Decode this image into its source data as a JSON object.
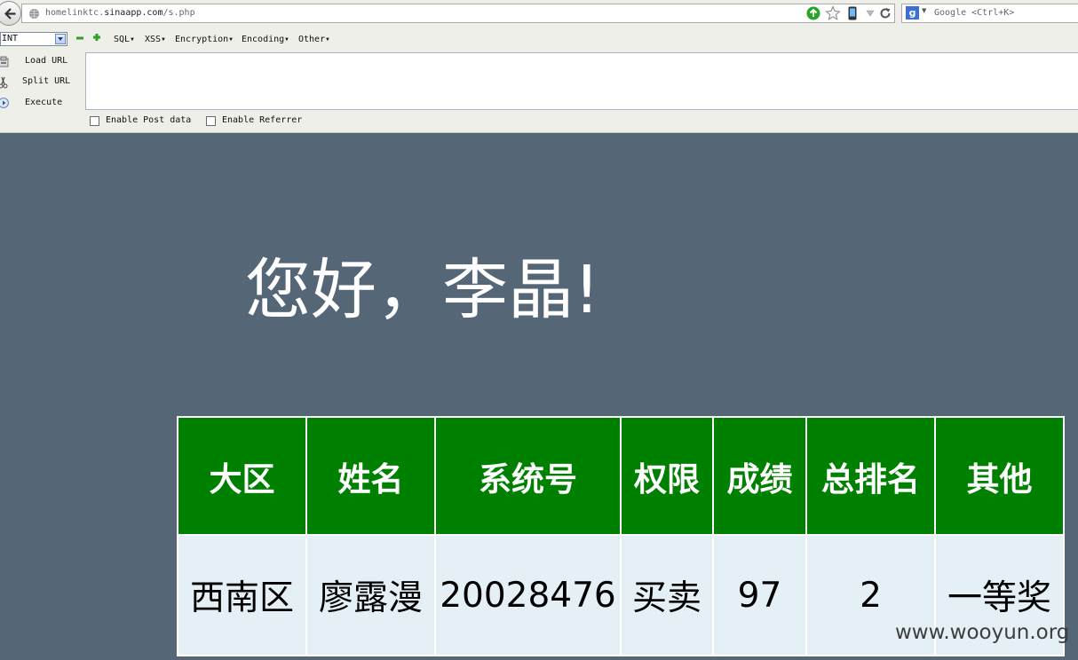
{
  "browser": {
    "url_host_prefix": "homelinktc.",
    "url_host_domain": "sinaapp.com",
    "url_path": "/s.php",
    "search_engine_letter": "g",
    "search_placeholder": "Google <Ctrl+K>"
  },
  "hackbar": {
    "mode_select_value": "INT",
    "menus": [
      {
        "label": "SQL"
      },
      {
        "label": "XSS"
      },
      {
        "label": "Encryption"
      },
      {
        "label": "Encoding"
      },
      {
        "label": "Other"
      }
    ],
    "buttons": {
      "load_url": "Load URL",
      "split_url": "Split URL",
      "execute": "Execute"
    },
    "textarea_value": "",
    "options": {
      "enable_post_data": "Enable Post data",
      "enable_referrer": "Enable Referrer"
    }
  },
  "page": {
    "greeting": "您好，李晶!",
    "table": {
      "headers": [
        "大区",
        "姓名",
        "系统号",
        "权限",
        "成绩",
        "总排名",
        "其他"
      ],
      "rows": [
        [
          "西南区",
          "廖露漫",
          "20028476",
          "买卖",
          "97",
          "2",
          "一等奖"
        ]
      ]
    },
    "watermark": "www.wooyun.org"
  },
  "colors": {
    "page_background": "#556677",
    "table_header_bg": "#008000",
    "table_cell_bg": "#e4f0f5"
  }
}
